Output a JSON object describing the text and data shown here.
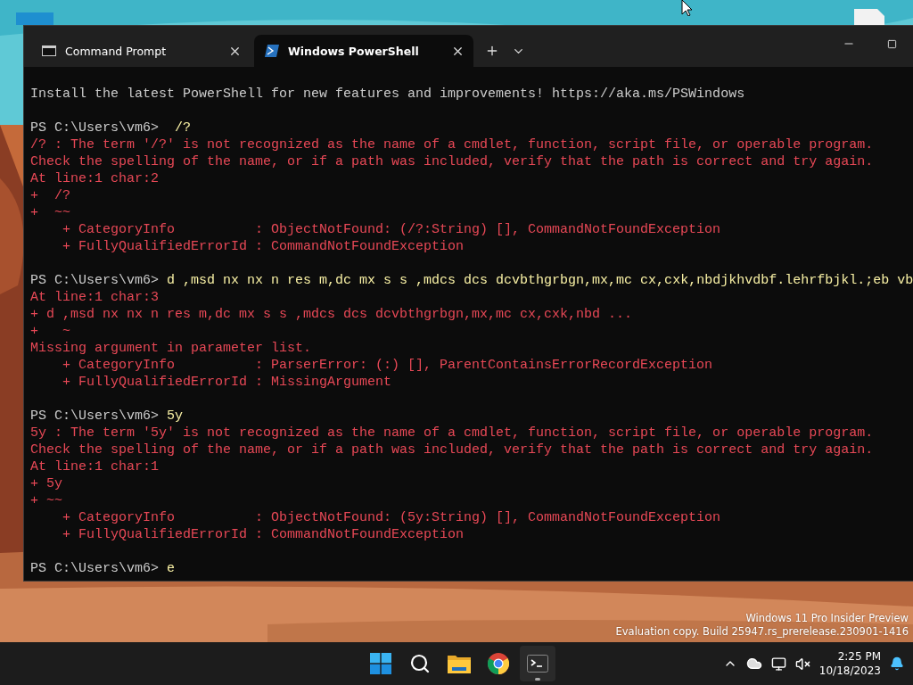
{
  "desktop": {
    "watermark": [
      "Windows 11 Pro Insider Preview",
      "Evaluation copy. Build 25947.rs_prerelease.230901-1416"
    ]
  },
  "window": {
    "tabs": [
      {
        "label": "Command Prompt",
        "selected": false
      },
      {
        "label": "Windows PowerShell",
        "selected": true
      }
    ]
  },
  "terminal": {
    "blocks": [
      [
        {
          "kind": "output",
          "text": "Install the latest PowerShell for new features and improvements! https://aka.ms/PSWindows"
        }
      ],
      [
        {
          "kind": "prompt",
          "prompt": "PS C:\\Users\\vm6>",
          "command": "  /?"
        },
        {
          "kind": "error",
          "text": "/? : The term '/?' is not recognized as the name of a cmdlet, function, script file, or operable program."
        },
        {
          "kind": "error",
          "text": "Check the spelling of the name, or if a path was included, verify that the path is correct and try again."
        },
        {
          "kind": "error",
          "text": "At line:1 char:2"
        },
        {
          "kind": "error",
          "text": "+  /?"
        },
        {
          "kind": "error",
          "text": "+  ~~"
        },
        {
          "kind": "error",
          "text": "    + CategoryInfo          : ObjectNotFound: (/?:String) [], CommandNotFoundException"
        },
        {
          "kind": "error",
          "text": "    + FullyQualifiedErrorId : CommandNotFoundException"
        }
      ],
      [
        {
          "kind": "prompt",
          "prompt": "PS C:\\Users\\vm6>",
          "command": " d ,msd nx nx n res m,dc mx s s ,mdcs dcs dcvbthgrbgn,mx,mc cx,cxk,nbdjkhvdbf.lehrfbjkl.;eb vb"
        },
        {
          "kind": "error",
          "text": "At line:1 char:3"
        },
        {
          "kind": "error",
          "text": "+ d ,msd nx nx n res m,dc mx s s ,mdcs dcs dcvbthgrbgn,mx,mc cx,cxk,nbd ..."
        },
        {
          "kind": "error",
          "text": "+   ~"
        },
        {
          "kind": "error",
          "text": "Missing argument in parameter list."
        },
        {
          "kind": "error",
          "text": "    + CategoryInfo          : ParserError: (:) [], ParentContainsErrorRecordException"
        },
        {
          "kind": "error",
          "text": "    + FullyQualifiedErrorId : MissingArgument"
        }
      ],
      [
        {
          "kind": "prompt",
          "prompt": "PS C:\\Users\\vm6>",
          "command": " 5y"
        },
        {
          "kind": "error",
          "text": "5y : The term '5y' is not recognized as the name of a cmdlet, function, script file, or operable program."
        },
        {
          "kind": "error",
          "text": "Check the spelling of the name, or if a path was included, verify that the path is correct and try again."
        },
        {
          "kind": "error",
          "text": "At line:1 char:1"
        },
        {
          "kind": "error",
          "text": "+ 5y"
        },
        {
          "kind": "error",
          "text": "+ ~~"
        },
        {
          "kind": "error",
          "text": "    + CategoryInfo          : ObjectNotFound: (5y:String) [], CommandNotFoundException"
        },
        {
          "kind": "error",
          "text": "    + FullyQualifiedErrorId : CommandNotFoundException"
        }
      ],
      [
        {
          "kind": "prompt",
          "prompt": "PS C:\\Users\\vm6>",
          "command": " e"
        }
      ]
    ]
  },
  "taskbar": {
    "apps": [
      {
        "running": false
      },
      {
        "running": false
      },
      {
        "running": false
      },
      {
        "running": false
      },
      {
        "running": true
      }
    ],
    "time": "2:25 PM",
    "date": "10/18/2023"
  }
}
